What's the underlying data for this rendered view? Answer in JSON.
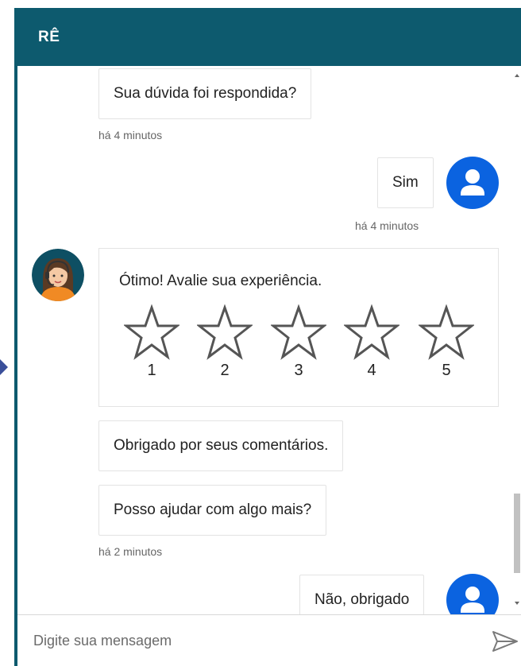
{
  "header": {
    "title": "RÊ"
  },
  "messages": {
    "agent_question": "Sua dúvida foi respondida?",
    "time_1": "há 4 minutos",
    "user_reply_1": "Sim",
    "time_2": "há 4 minutos",
    "rating": {
      "prompt": "Ótimo! Avalie sua experiência.",
      "stars": [
        "1",
        "2",
        "3",
        "4",
        "5"
      ]
    },
    "agent_thanks": "Obrigado por seus comentários.",
    "agent_more_help": "Posso ajudar com algo mais?",
    "time_3": "há 2 minutos",
    "user_reply_2": "Não, obrigado"
  },
  "input": {
    "placeholder": "Digite sua mensagem"
  },
  "icons": {
    "user_avatar": "user-avatar-icon",
    "agent_avatar": "agent-avatar-icon",
    "star": "star-outline-icon",
    "send": "send-icon"
  },
  "colors": {
    "header_bg": "#0d5a6e",
    "user_avatar_bg": "#0b63e0",
    "agent_shirt": "#f08a24"
  }
}
